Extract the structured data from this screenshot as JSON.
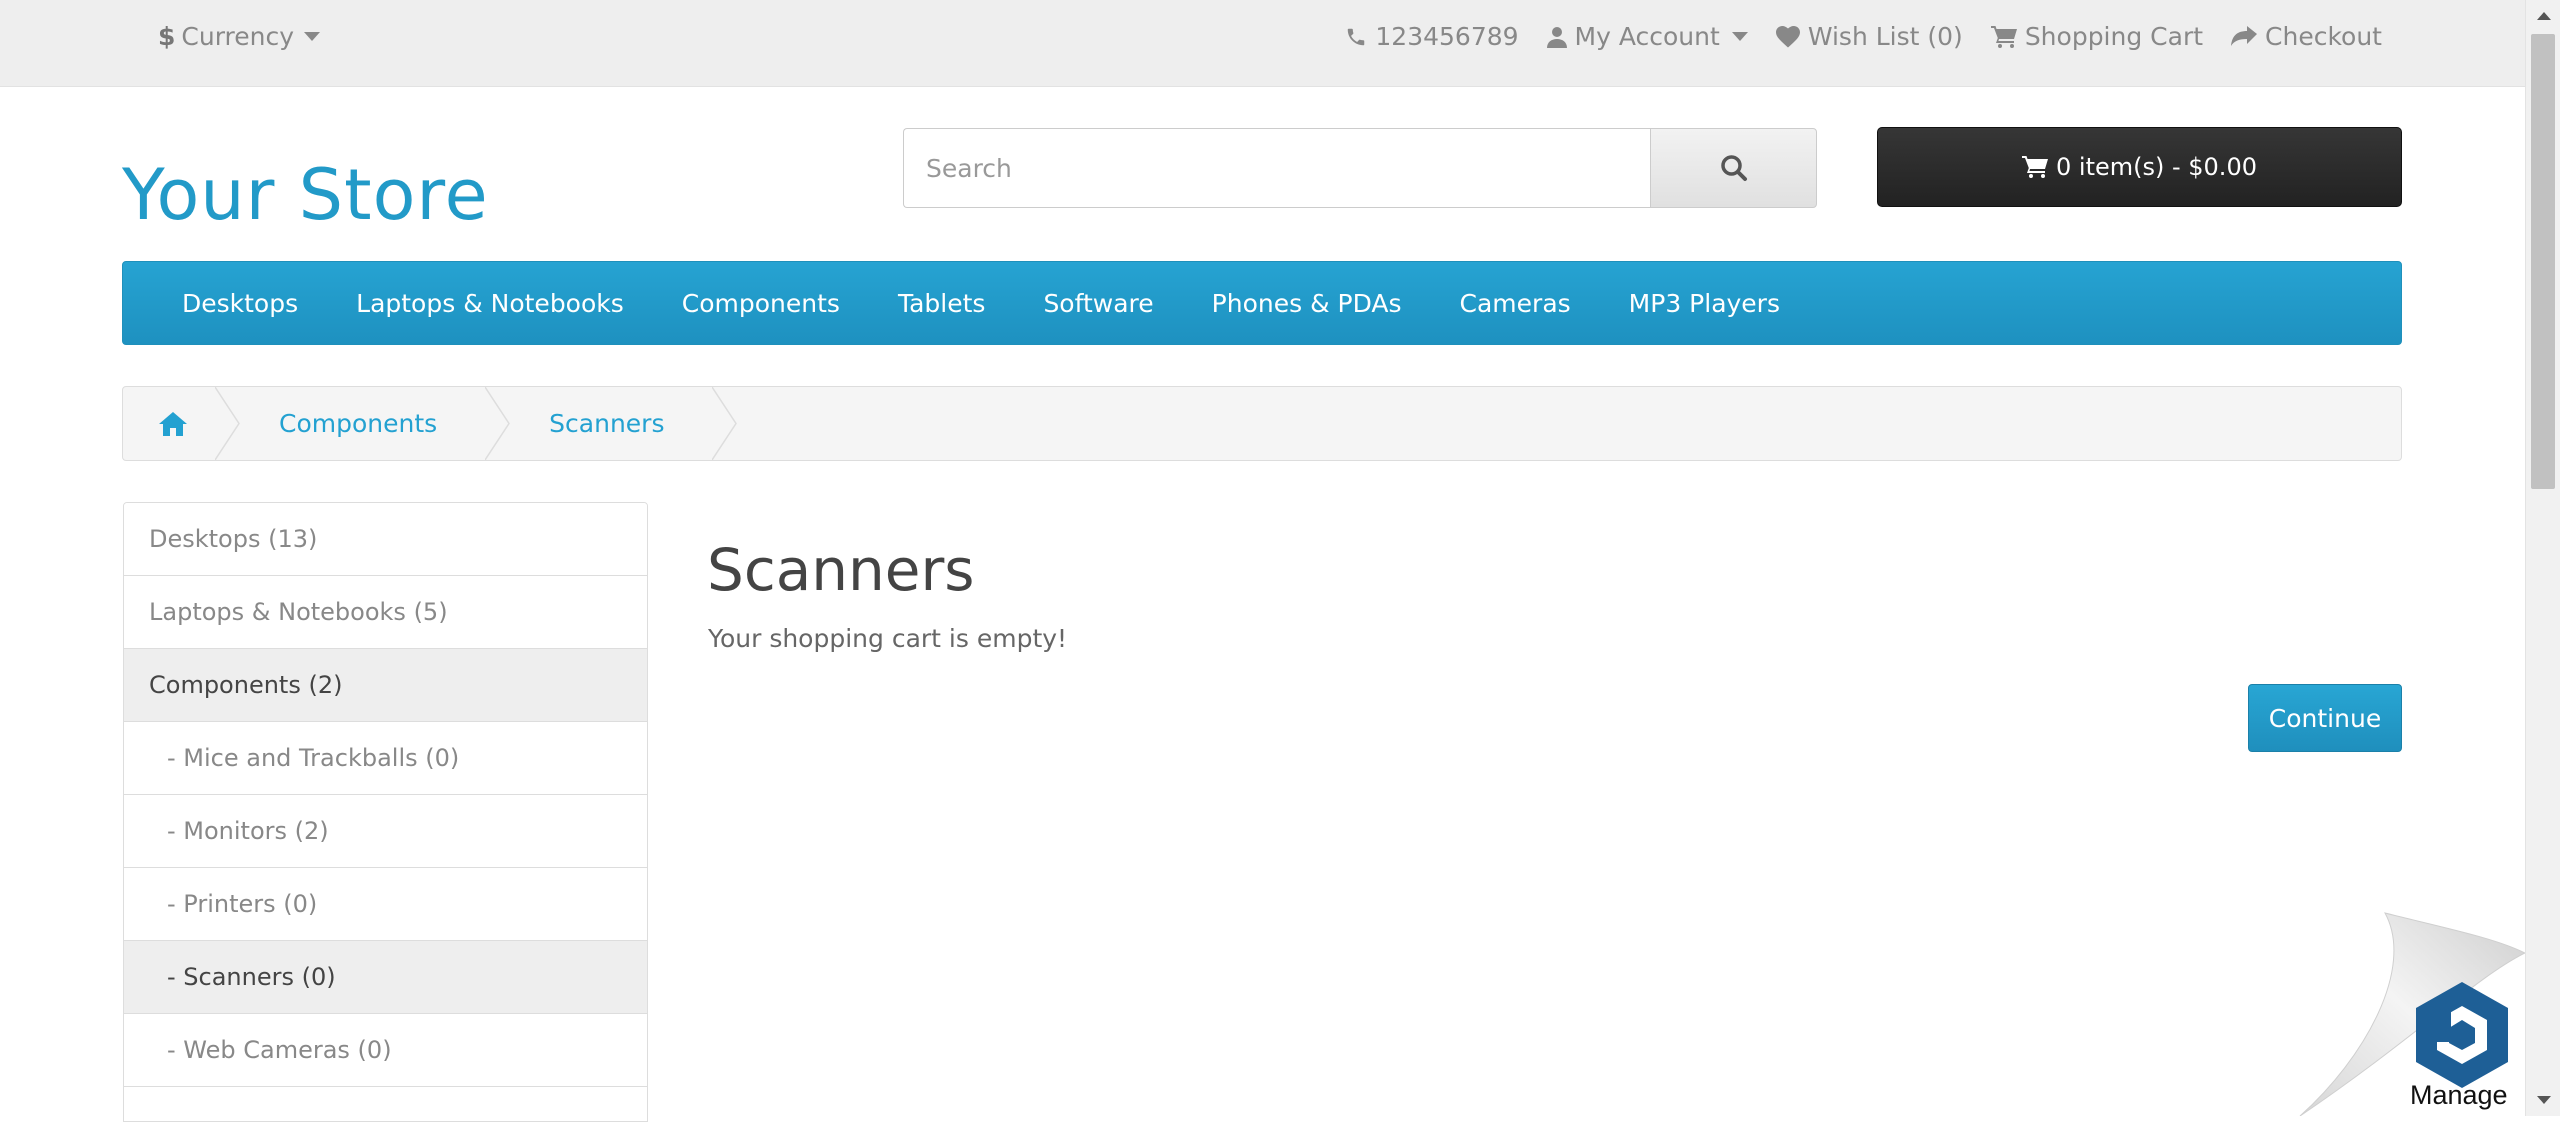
{
  "topbar": {
    "currency_symbol": "$",
    "currency_label": "Currency",
    "phone": "123456789",
    "my_account": "My Account",
    "wishlist": "Wish List (0)",
    "shopping_cart": "Shopping Cart",
    "checkout": "Checkout"
  },
  "header": {
    "logo": "Your Store",
    "search_placeholder": "Search",
    "cart_summary": "0 item(s) - $0.00"
  },
  "menu": {
    "items": [
      "Desktops",
      "Laptops & Notebooks",
      "Components",
      "Tablets",
      "Software",
      "Phones & PDAs",
      "Cameras",
      "MP3 Players"
    ]
  },
  "breadcrumb": {
    "items": [
      "Components",
      "Scanners"
    ]
  },
  "sidebar": {
    "items": [
      {
        "label": "Desktops (13)"
      },
      {
        "label": "Laptops & Notebooks (5)"
      },
      {
        "label": "Components (2)"
      },
      {
        "label": "- Mice and Trackballs (0)"
      },
      {
        "label": "- Monitors (2)"
      },
      {
        "label": "- Printers (0)"
      },
      {
        "label": "- Scanners (0)"
      },
      {
        "label": "- Web Cameras (0)"
      }
    ]
  },
  "content": {
    "title": "Scanners",
    "message": "Your shopping cart is empty!",
    "continue_label": "Continue"
  },
  "widget": {
    "label": "Manage"
  },
  "colors": {
    "accent": "#229ac8",
    "cart_button": "#2b2b2b",
    "topbar": "#eeeeee"
  }
}
